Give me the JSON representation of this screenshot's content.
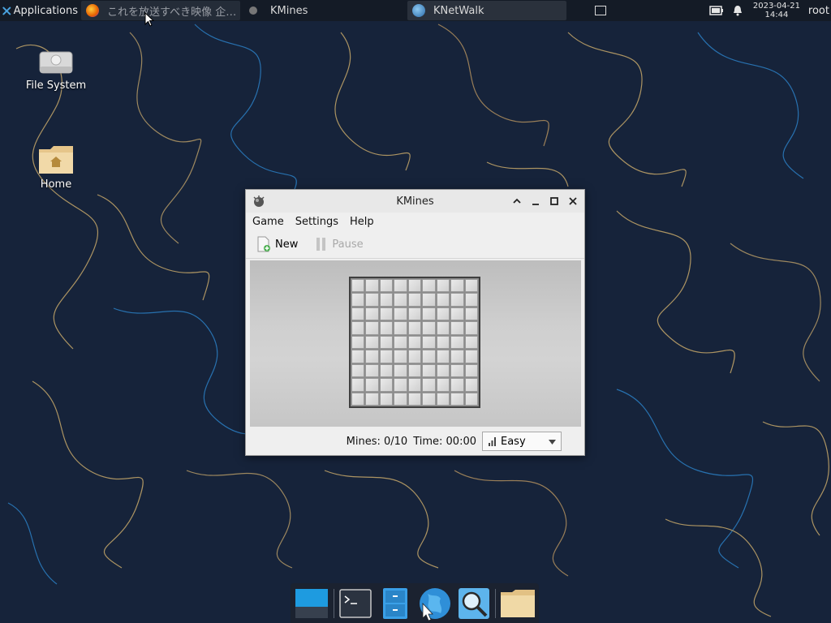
{
  "panel": {
    "applications_label": "Applications",
    "tasks": [
      {
        "label": "これを放送すべき映像 企…",
        "icon": "firefox-icon"
      },
      {
        "label": "KMines",
        "icon": "kmines-icon"
      },
      {
        "label": "KNetWalk",
        "icon": "knetwalk-icon"
      }
    ],
    "clock_date": "2023-04-21",
    "clock_time": "14:44",
    "user": "root"
  },
  "desktop": {
    "icons": [
      {
        "label": "File System",
        "icon": "drive-icon"
      },
      {
        "label": "Home",
        "icon": "home-folder-icon"
      }
    ]
  },
  "window": {
    "title": "KMines",
    "menu": [
      "Game",
      "Settings",
      "Help"
    ],
    "toolbar": {
      "new_label": "New",
      "pause_label": "Pause"
    },
    "board": {
      "columns": 9,
      "rows": 9
    },
    "status": {
      "mines": "Mines: 0/10",
      "time": "Time: 00:00",
      "difficulty": "Easy"
    }
  },
  "dock": {
    "items": [
      "desktop-icon",
      "terminal-icon",
      "file-manager-icon",
      "browser-icon",
      "search-icon",
      "folder-icon"
    ]
  },
  "colors": {
    "panel_bg": "#141b26",
    "desktop_bg": "#16233a",
    "window_bg": "#efefef",
    "accent_blue": "#1e90d8"
  }
}
